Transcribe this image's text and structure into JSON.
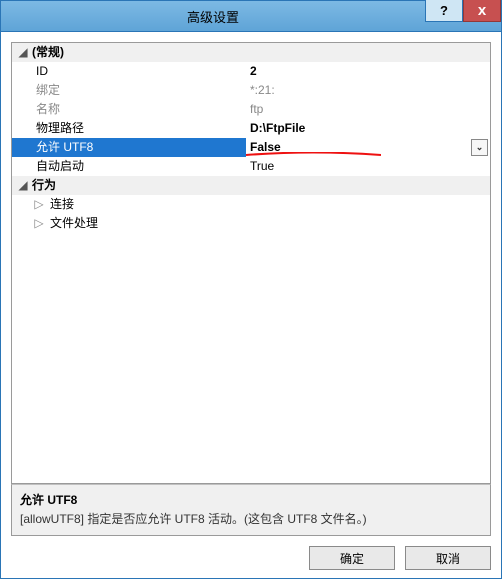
{
  "titlebar": {
    "title": "高级设置",
    "help_label": "?",
    "close_label": "x"
  },
  "categories": {
    "general": {
      "label": "(常规)",
      "id_label": "ID",
      "id_value": "2",
      "binding_label": "绑定",
      "binding_value": "*:21:",
      "name_label": "名称",
      "name_value": "ftp",
      "physpath_label": "物理路径",
      "physpath_value": "D:\\FtpFile",
      "allowutf8_label": "允许 UTF8",
      "allowutf8_value": "False",
      "autostart_label": "自动启动",
      "autostart_value": "True"
    },
    "behavior": {
      "label": "行为",
      "connections_label": "连接",
      "filehandling_label": "文件处理"
    }
  },
  "description": {
    "title": "允许 UTF8",
    "text": "[allowUTF8] 指定是否应允许 UTF8 活动。(这包含 UTF8 文件名。)"
  },
  "buttons": {
    "ok": "确定",
    "cancel": "取消"
  },
  "glyphs": {
    "expanded": "◢",
    "collapsed": "▷",
    "dropdown": "⌄"
  }
}
